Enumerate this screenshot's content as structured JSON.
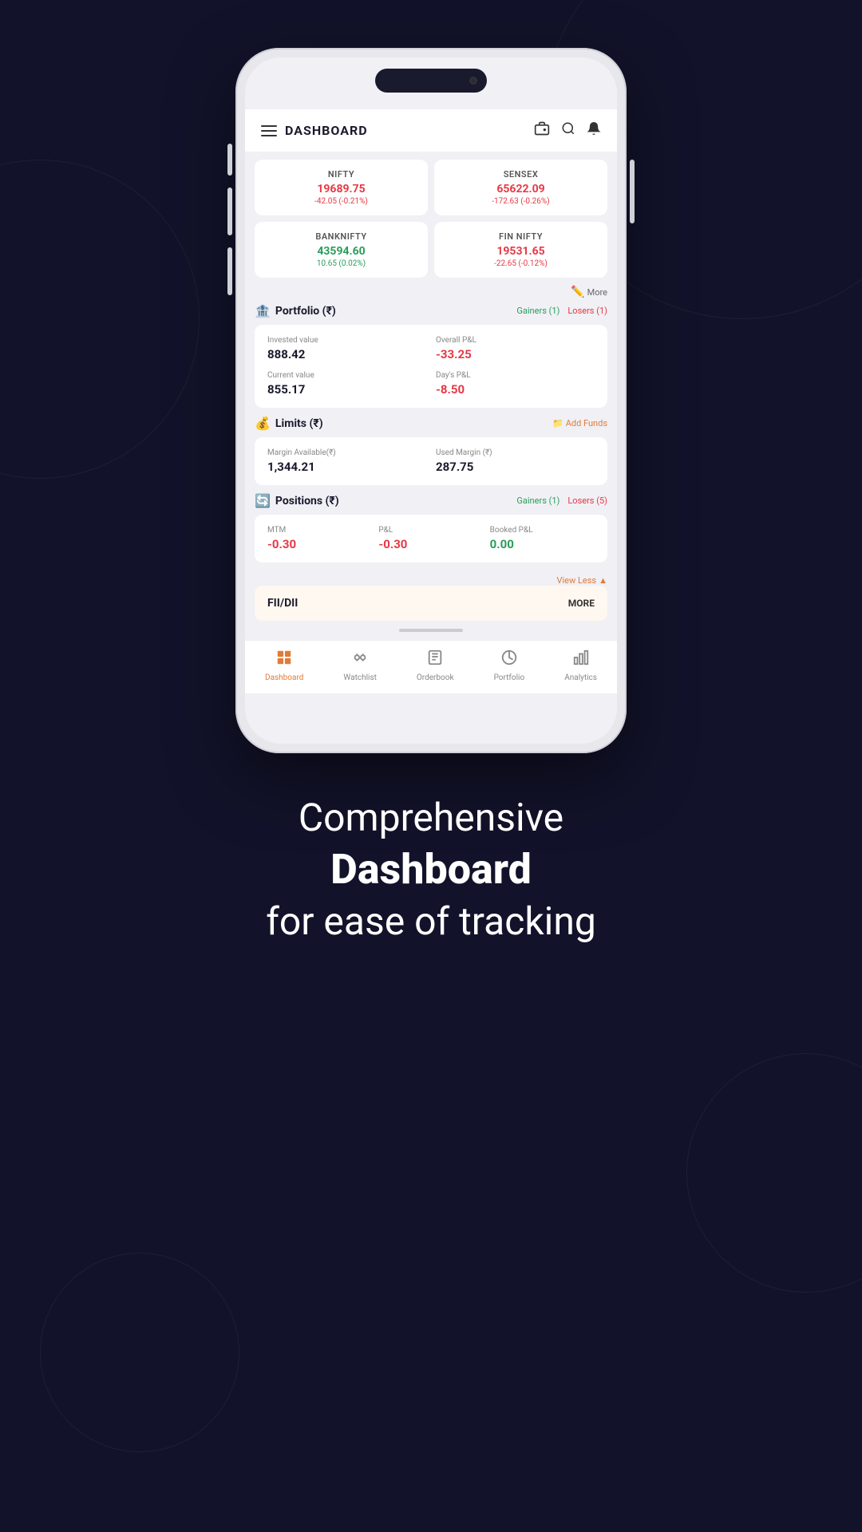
{
  "background": {
    "color": "#12132a"
  },
  "header": {
    "title": "DASHBOARD",
    "icons": [
      "wallet-icon",
      "search-icon",
      "bell-icon"
    ]
  },
  "market": {
    "cards": [
      {
        "name": "NIFTY",
        "price": "19689.75",
        "change": "-42.05 (-0.21%)",
        "direction": "down"
      },
      {
        "name": "SENSEX",
        "price": "65622.09",
        "change": "-172.63 (-0.26%)",
        "direction": "down"
      },
      {
        "name": "BANKNIFTY",
        "price": "43594.60",
        "change": "10.65 (0.02%)",
        "direction": "up"
      },
      {
        "name": "FIN NIFTY",
        "price": "19531.65",
        "change": "-22.65 (-0.12%)",
        "direction": "down"
      }
    ],
    "more_label": "More"
  },
  "portfolio": {
    "title": "Portfolio (₹)",
    "gainers_label": "Gainers (1)",
    "losers_label": "Losers (1)",
    "invested_value_label": "Invested value",
    "invested_value": "888.42",
    "overall_pl_label": "Overall P&L",
    "overall_pl": "-33.25",
    "current_value_label": "Current value",
    "current_value": "855.17",
    "days_pl_label": "Day's P&L",
    "days_pl": "-8.50"
  },
  "limits": {
    "title": "Limits (₹)",
    "add_funds_label": "Add Funds",
    "margin_available_label": "Margin Available(₹)",
    "margin_available": "1,344.21",
    "used_margin_label": "Used Margin (₹)",
    "used_margin": "287.75"
  },
  "positions": {
    "title": "Positions (₹)",
    "gainers_label": "Gainers (1)",
    "losers_label": "Losers (5)",
    "mtm_label": "MTM",
    "mtm_value": "-0.30",
    "pl_label": "P&L",
    "pl_value": "-0.30",
    "booked_pl_label": "Booked P&L",
    "booked_pl_value": "0.00",
    "view_less_label": "View Less"
  },
  "fii_dii": {
    "title": "FII/DII",
    "more_label": "MORE"
  },
  "bottom_nav": {
    "items": [
      {
        "label": "Dashboard",
        "active": true
      },
      {
        "label": "Watchlist",
        "active": false
      },
      {
        "label": "Orderbook",
        "active": false
      },
      {
        "label": "Portfolio",
        "active": false
      },
      {
        "label": "Analytics",
        "active": false
      }
    ]
  },
  "marketing": {
    "line1": "Comprehensive",
    "line2": "Dashboard",
    "line3": "for ease of tracking"
  }
}
